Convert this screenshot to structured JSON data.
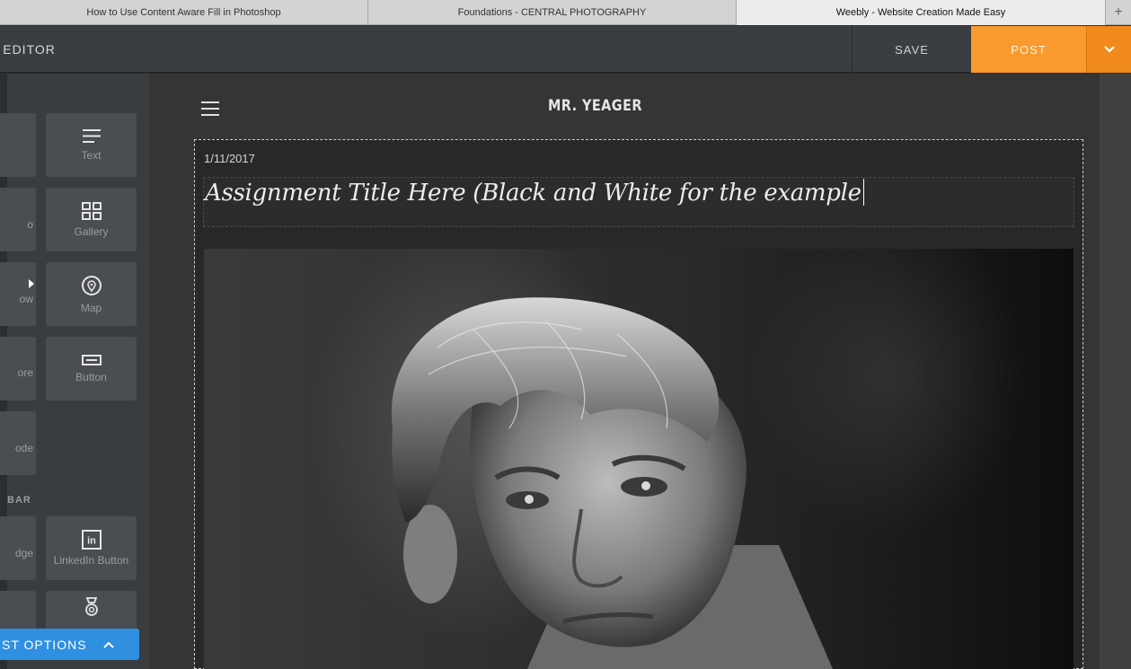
{
  "browser": {
    "tabs": [
      "How to Use Content Aware Fill in Photoshop",
      "Foundations - CENTRAL PHOTOGRAPHY",
      "Weebly - Website Creation Made Easy"
    ],
    "new_tab": "+"
  },
  "header": {
    "title": "S EDITOR",
    "save": "SAVE",
    "post": "POST"
  },
  "sidebar": {
    "tiles": [
      {
        "label": "Text",
        "icon": "text-icon"
      },
      {
        "label": "Gallery",
        "icon": "gallery-icon"
      },
      {
        "label": "Map",
        "icon": "map-pin-icon"
      },
      {
        "label": "Button",
        "icon": "button-icon"
      },
      {
        "label": "LinkedIn Button",
        "icon": "linkedin-icon"
      },
      {
        "label": "",
        "icon": "badge-icon"
      }
    ],
    "cut_tiles": [
      {
        "label": ""
      },
      {
        "label": "o"
      },
      {
        "label": "ow",
        "icon": "play-icon"
      },
      {
        "label": "ore"
      },
      {
        "label": "ode"
      },
      {
        "label": "dge"
      },
      {
        "label": ""
      }
    ],
    "section_label": "BAR",
    "post_options": "ST OPTIONS"
  },
  "site": {
    "title": "MR. YEAGER"
  },
  "post": {
    "date": "1/11/2017",
    "title": "Assignment Title Here (Black and White for the example"
  },
  "colors": {
    "accent_orange": "#f99a2e",
    "accent_blue": "#2f8fe0",
    "sidebar_bg": "#3a3d40",
    "tile_bg": "#4a4d51"
  }
}
